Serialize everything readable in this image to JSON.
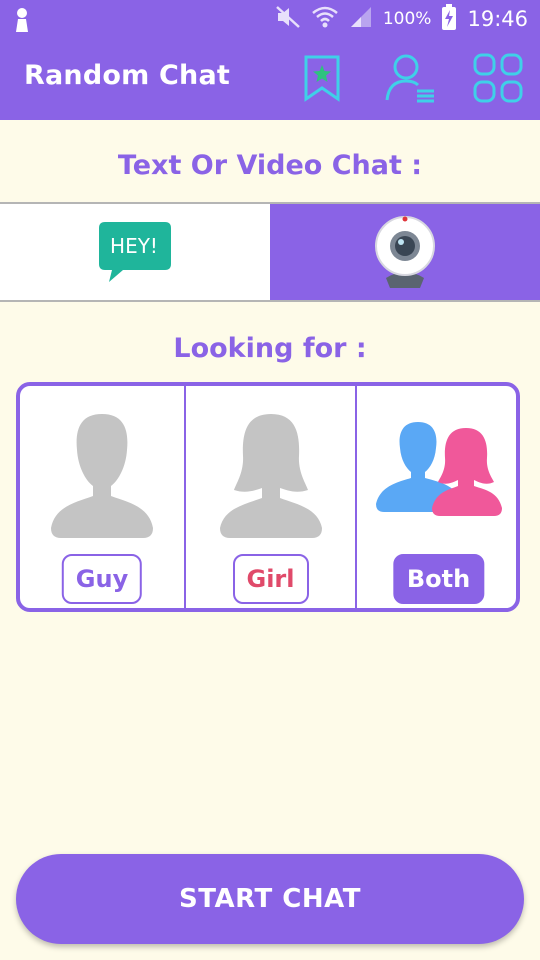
{
  "status_bar": {
    "battery_percent": "100%",
    "time": "19:46",
    "icons": [
      "person-icon",
      "mute-icon",
      "wifi-icon",
      "signal-icon",
      "battery-charging-icon"
    ]
  },
  "app_bar": {
    "title": "Random Chat",
    "actions": [
      "bookmark-star-icon",
      "user-list-icon",
      "grid-icon"
    ]
  },
  "chat_mode": {
    "heading": "Text Or Video Chat :",
    "text_bubble_label": "HEY!",
    "selected": "video"
  },
  "looking_for": {
    "heading": "Looking for :",
    "options": [
      {
        "label": "Guy",
        "color": "#8a63e6"
      },
      {
        "label": "Girl",
        "color": "#e04a6a"
      },
      {
        "label": "Both",
        "color": "#ffffff"
      }
    ],
    "selected": "Both"
  },
  "start_button": {
    "label": "START CHAT"
  },
  "colors": {
    "primary": "#8a63e6",
    "background": "#fefbe9",
    "bubble": "#1fb59b",
    "both_male": "#5aa8f5",
    "both_female": "#f0589a",
    "silhouette": "#c4c4c4"
  }
}
